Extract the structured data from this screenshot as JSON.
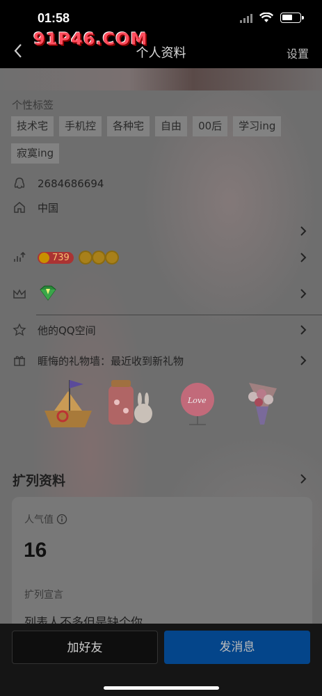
{
  "status_bar": {
    "time": "01:58"
  },
  "watermark": "91P46.COM",
  "nav": {
    "title": "个人资料",
    "settings_label": "设置"
  },
  "profile": {
    "tags_label": "个性标签",
    "tags": [
      "技术宅",
      "手机控",
      "各种宅",
      "自由",
      "00后",
      "学习ing",
      "寂寞ing"
    ],
    "qq_number": "2684686694",
    "location": "中国",
    "level_number": "739",
    "qzone_label": "他的QQ空间",
    "gift_wall_label": "睚悔的礼物墙：最近收到新礼物"
  },
  "expand": {
    "title": "扩列资料",
    "popularity_label": "人气值",
    "popularity_value": "16",
    "manifesto_label": "扩列宣言",
    "manifesto_text": "列表人不多但是缺个你"
  },
  "bottom": {
    "add_friend": "加好友",
    "send_message": "发消息"
  },
  "colors": {
    "accent": "#04458a",
    "watermark": "#ff4d5d"
  }
}
